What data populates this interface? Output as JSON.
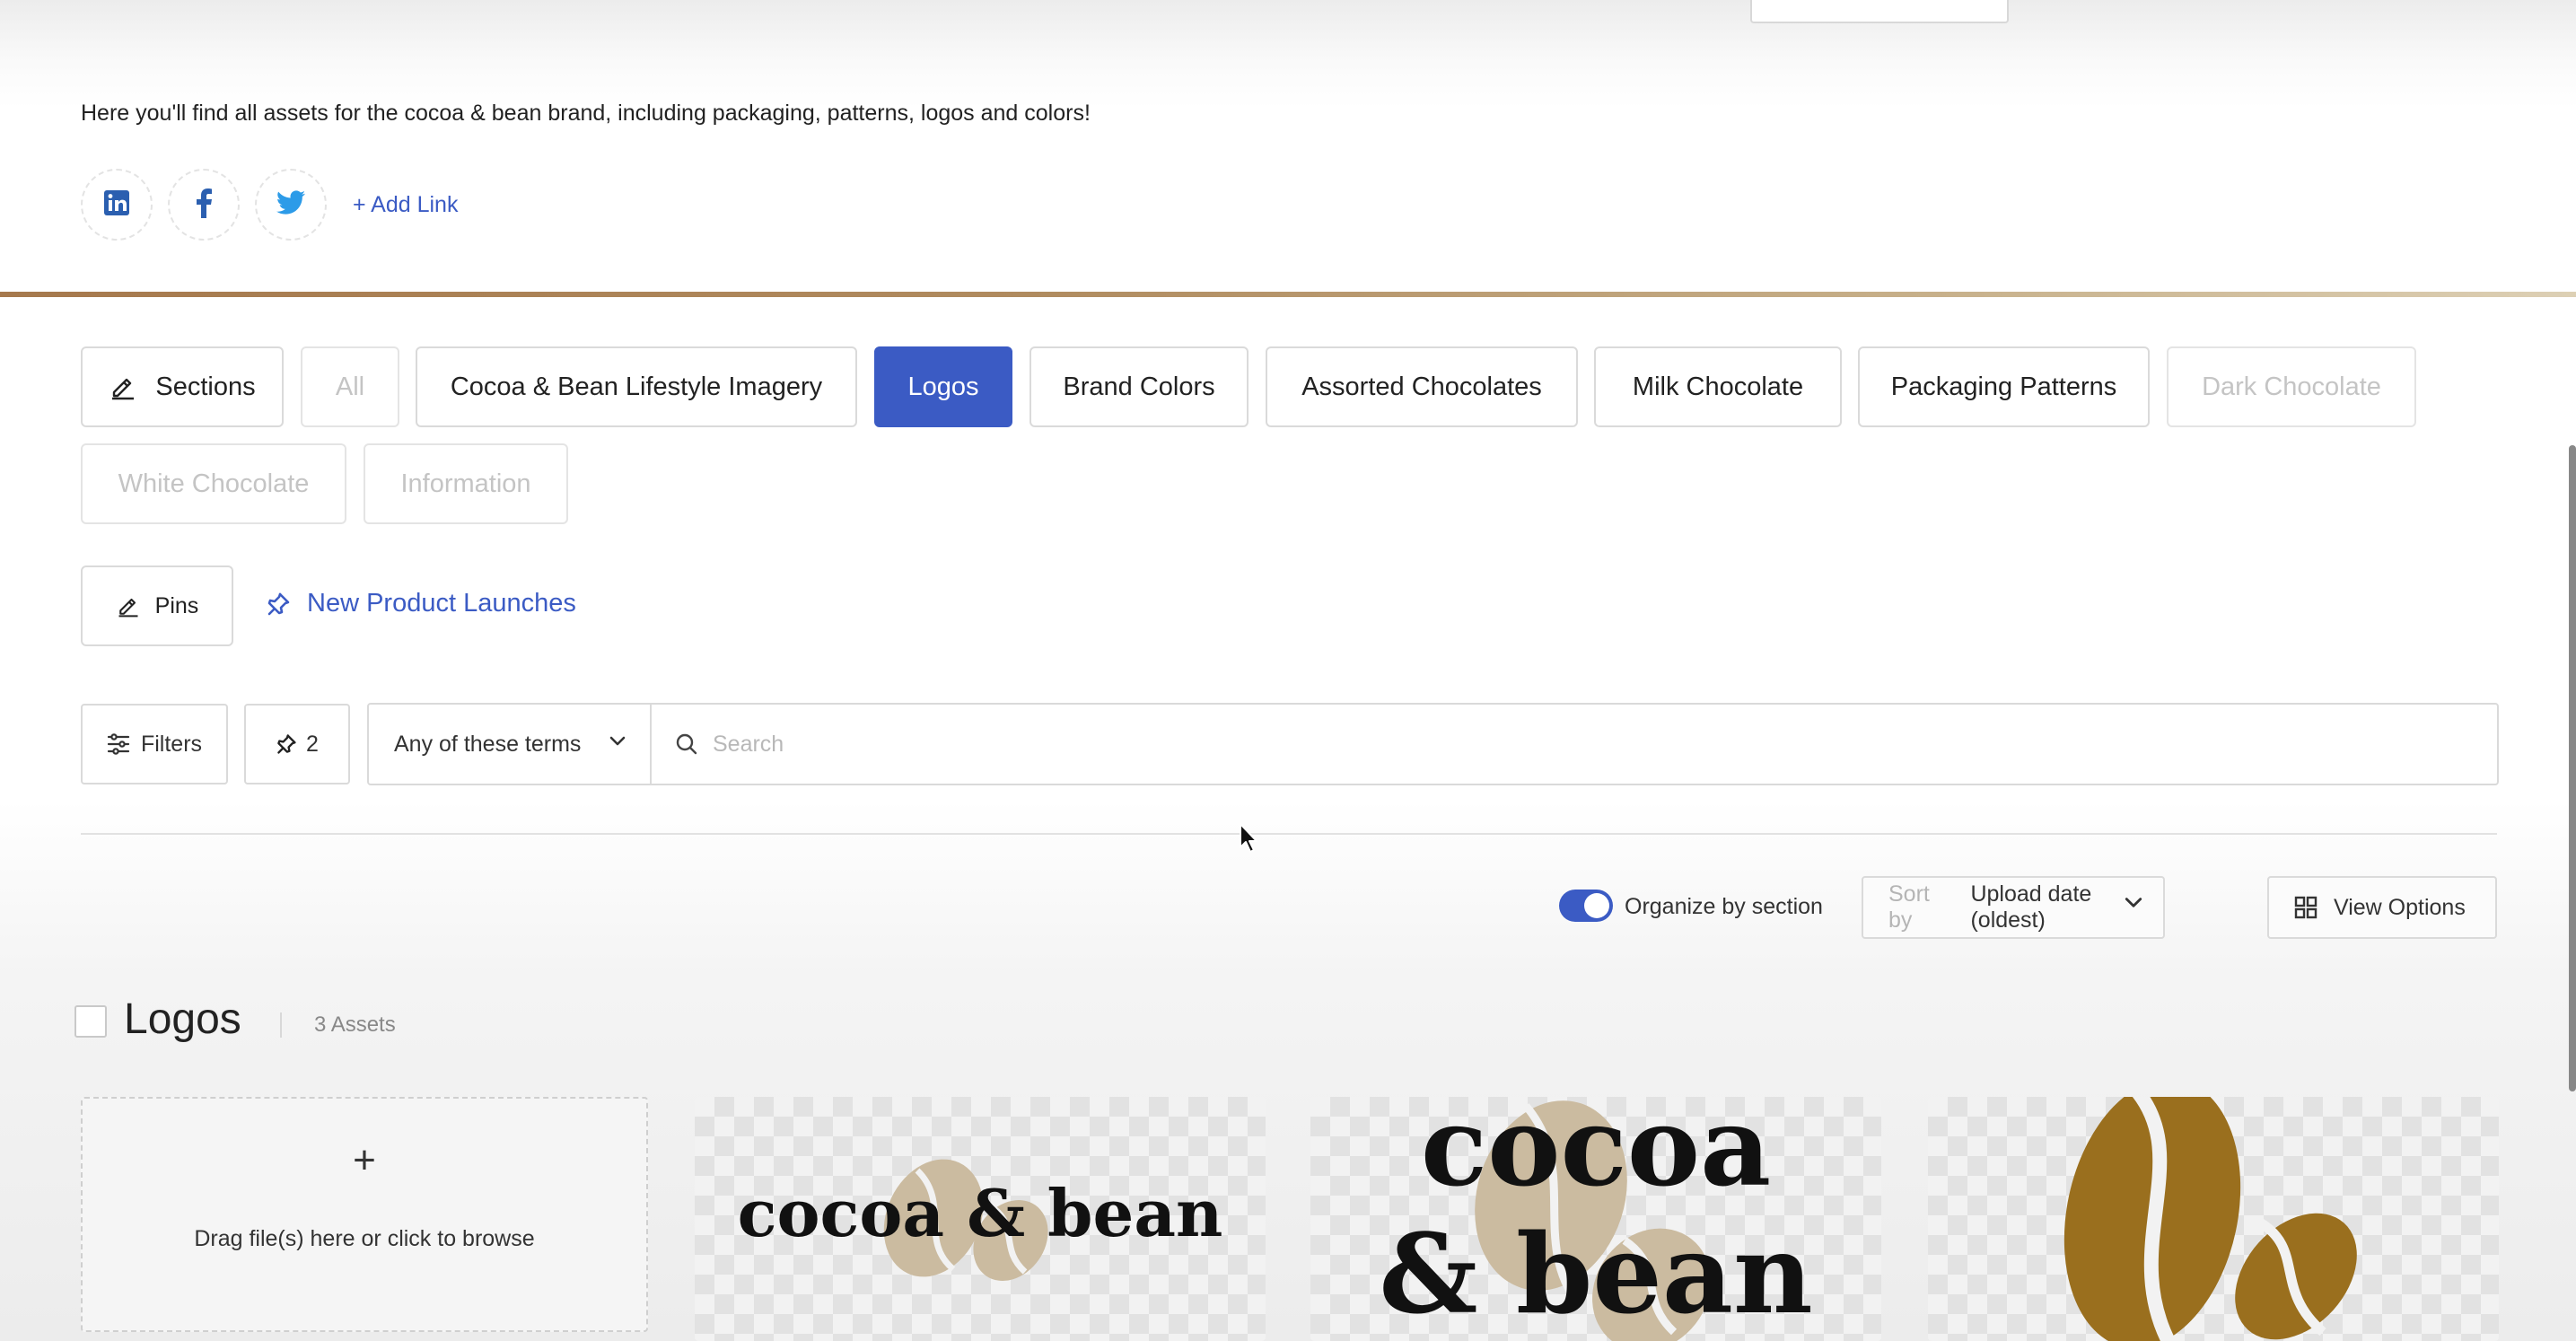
{
  "header": {
    "description": "Here you'll find all assets for the cocoa & bean brand, including packaging, patterns, logos and colors!",
    "social_links": [
      {
        "icon": "linkedin-icon",
        "color": "#2b5fb0"
      },
      {
        "icon": "facebook-icon",
        "color": "#2b5fb0"
      },
      {
        "icon": "twitter-icon",
        "color": "#2c9be8"
      }
    ],
    "add_link_label": "+ Add Link"
  },
  "sections": {
    "edit_label": "Sections",
    "tabs": [
      {
        "label": "All",
        "state": "disabled"
      },
      {
        "label": "Cocoa & Bean Lifestyle Imagery",
        "state": "normal"
      },
      {
        "label": "Logos",
        "state": "active"
      },
      {
        "label": "Brand Colors",
        "state": "normal"
      },
      {
        "label": "Assorted Chocolates",
        "state": "normal"
      },
      {
        "label": "Milk Chocolate",
        "state": "normal"
      },
      {
        "label": "Packaging Patterns",
        "state": "normal"
      },
      {
        "label": "Dark Chocolate",
        "state": "disabled"
      },
      {
        "label": "White Chocolate",
        "state": "disabled"
      },
      {
        "label": "Information",
        "state": "disabled"
      }
    ]
  },
  "pins": {
    "edit_label": "Pins",
    "items": [
      {
        "label": "New Product Launches"
      }
    ]
  },
  "toolbar": {
    "filters_label": "Filters",
    "pin_count": "2",
    "match_mode": "Any of these terms",
    "search_placeholder": "Search"
  },
  "view_controls": {
    "organize_label": "Organize by section",
    "organize_on": true,
    "sort_label": "Sort by",
    "sort_value": "Upload date (oldest)",
    "view_options_label": "View Options"
  },
  "section": {
    "title": "Logos",
    "count": "3 Assets",
    "dropzone_text": "Drag file(s) here or click to browse",
    "assets": [
      {
        "logo_text": "cocoa & bean",
        "variant": "wordmark"
      },
      {
        "logo_text_line1": "cocoa",
        "logo_text_line2": "& bean",
        "variant": "stacked"
      },
      {
        "variant": "beans-icon"
      }
    ]
  },
  "colors": {
    "accent": "#3b5bc4",
    "gold_bean": "#9a6f1e",
    "beige_bean": "#cbbba0"
  }
}
